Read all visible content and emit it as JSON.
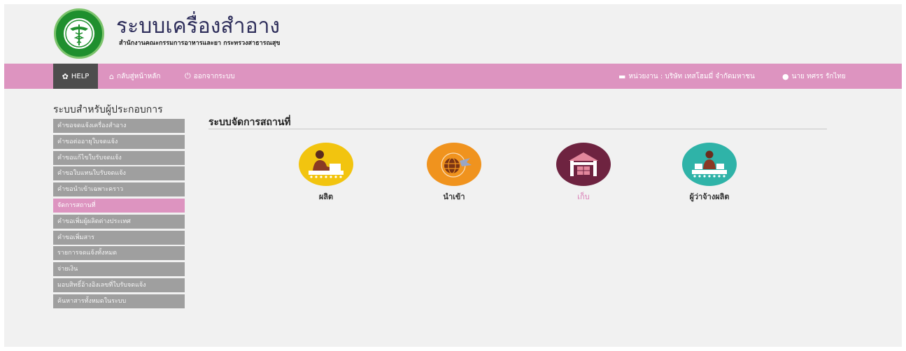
{
  "header": {
    "title": "ระบบเครื่องสำอาง",
    "subtitle": "สำนักงานคณะกรรมการอาหารและยา กระทรวงสาธารณสุข"
  },
  "navbar": {
    "help_label": "HELP",
    "home_label": "กลับสู่หน้าหลัก",
    "logout_label": "ออกจากระบบ",
    "agency_label": "หน่วยงาน : บริษัท เทสโฮมมี่ จำกัดมหาชน",
    "user_label": "นาย ทศรร รักไทย"
  },
  "sidebar": {
    "heading": "ระบบสำหรับผู้ประกอบการ",
    "items": [
      {
        "label": "คำขอจดแจ้งเครื่องสำอาง"
      },
      {
        "label": "คำขอต่ออายุใบจดแจ้ง"
      },
      {
        "label": "คำขอแก้ไขใบรับจดแจ้ง"
      },
      {
        "label": "คำขอใบแทนใบรับจดแจ้ง"
      },
      {
        "label": "คำขอนำเข้าเฉพาะคราว"
      },
      {
        "label": "จัดการสถานที่"
      },
      {
        "label": "คำขอเพิ่มผู้ผลิตต่างประเทศ"
      },
      {
        "label": "คำขอเพิ่มสาร"
      },
      {
        "label": "รายการจดแจ้งทั้งหมด"
      },
      {
        "label": "จ่ายเงิน"
      },
      {
        "label": "มอบสิทธิ์อ้างอิงเลขที่ใบรับจดแจ้ง"
      },
      {
        "label": "ค้นหาสารทั้งหมดในระบบ"
      }
    ],
    "active_item": "จัดการสถานที่"
  },
  "main": {
    "title": "ระบบจัดการสถานที่",
    "tiles": [
      {
        "label": "ผลิต",
        "icon": "factory-worker-icon",
        "color": "#f2c40f"
      },
      {
        "label": "นำเข้า",
        "icon": "globe-import-icon",
        "color": "#f0931e"
      },
      {
        "label": "เก็บ",
        "icon": "warehouse-icon",
        "color": "#6e2340"
      },
      {
        "label": "ผู้ว่าจ้างผลิต",
        "icon": "conveyor-worker-icon",
        "color": "#2fb3a8"
      }
    ]
  },
  "colors": {
    "navbar": "#dd94c0",
    "help_bg": "#4d4d4d",
    "sidebar_item": "#9f9f9f",
    "logo_green": "#1f8f2e"
  }
}
